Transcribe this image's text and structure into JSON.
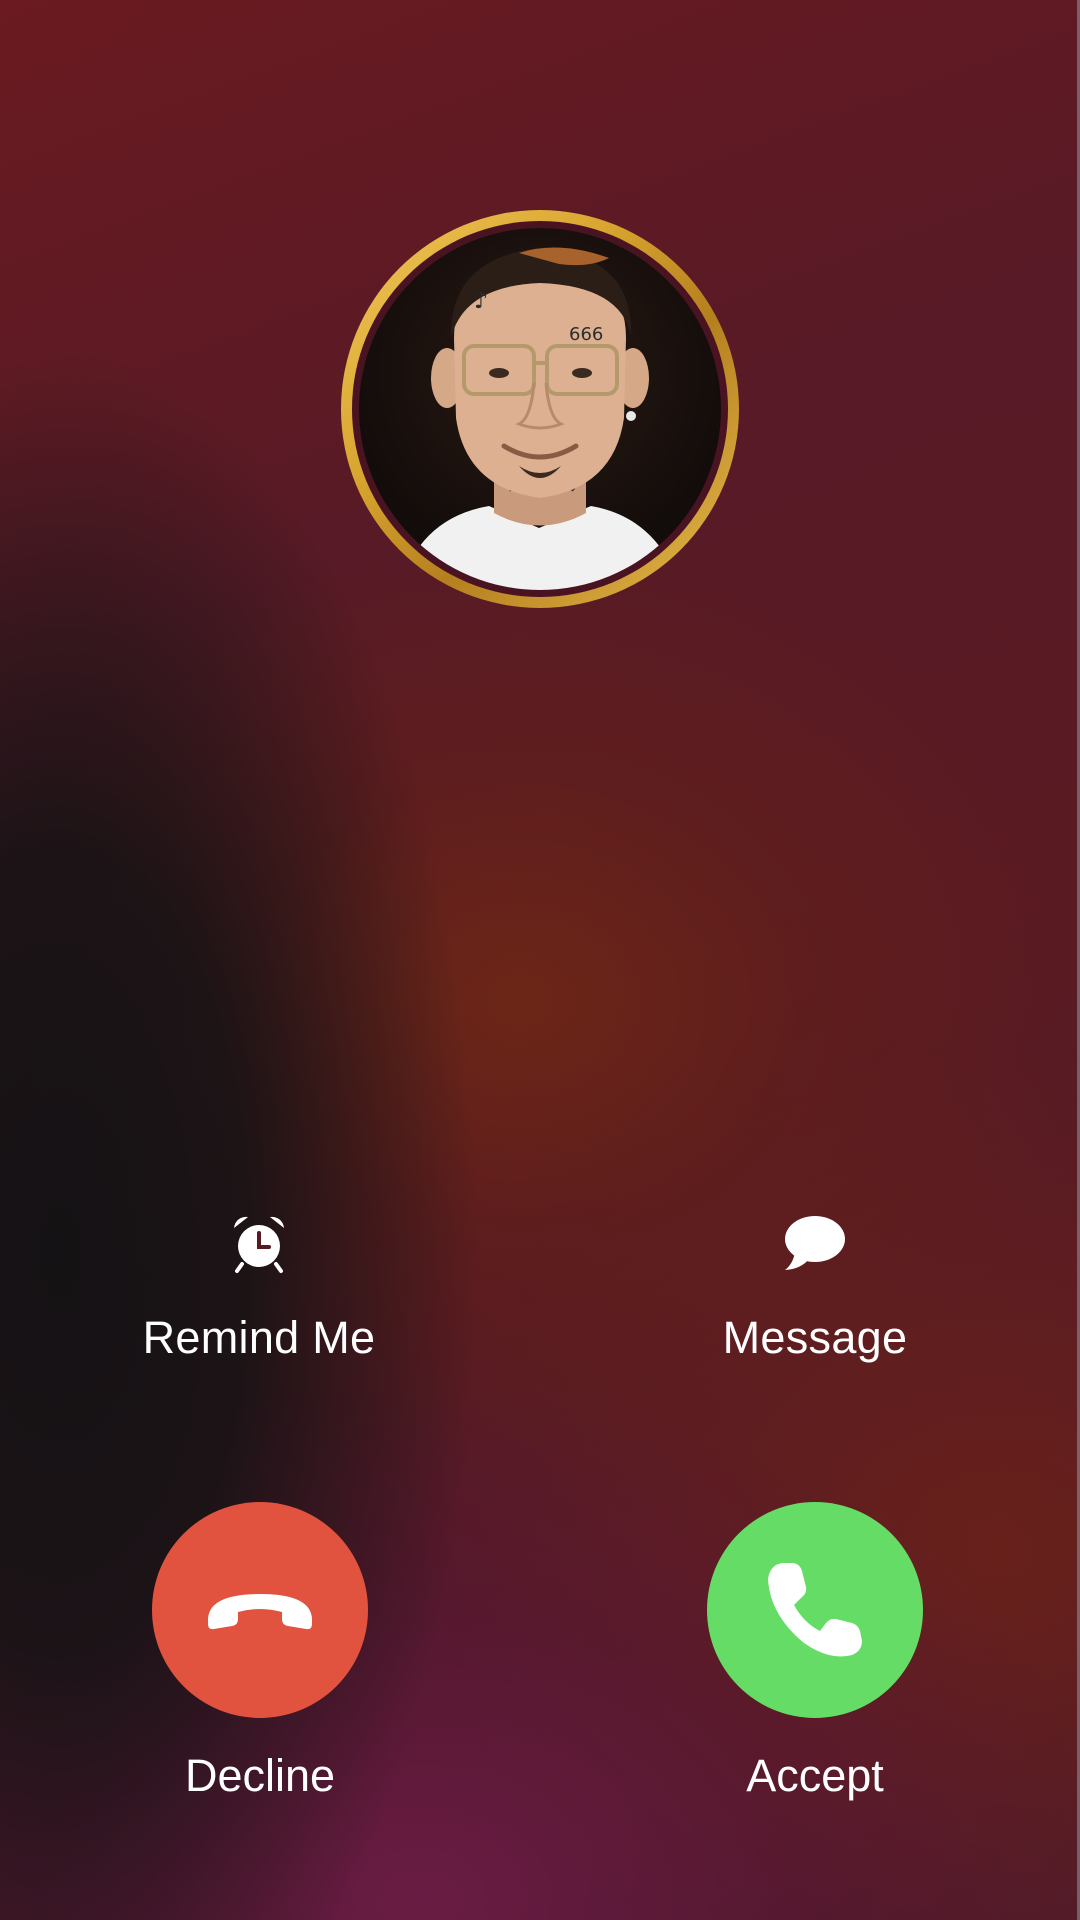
{
  "screen": "incoming-call",
  "caller": {
    "avatar_icon": "caller-photo",
    "ring_color": "#d9a630"
  },
  "quick_actions": {
    "remind": {
      "label": "Remind Me",
      "icon": "alarm-clock-icon"
    },
    "message": {
      "label": "Message",
      "icon": "speech-bubble-icon"
    }
  },
  "call_actions": {
    "decline": {
      "label": "Decline",
      "icon": "phone-hangup-icon",
      "color": "#e1533f"
    },
    "accept": {
      "label": "Accept",
      "icon": "phone-icon",
      "color": "#65dc65"
    }
  }
}
